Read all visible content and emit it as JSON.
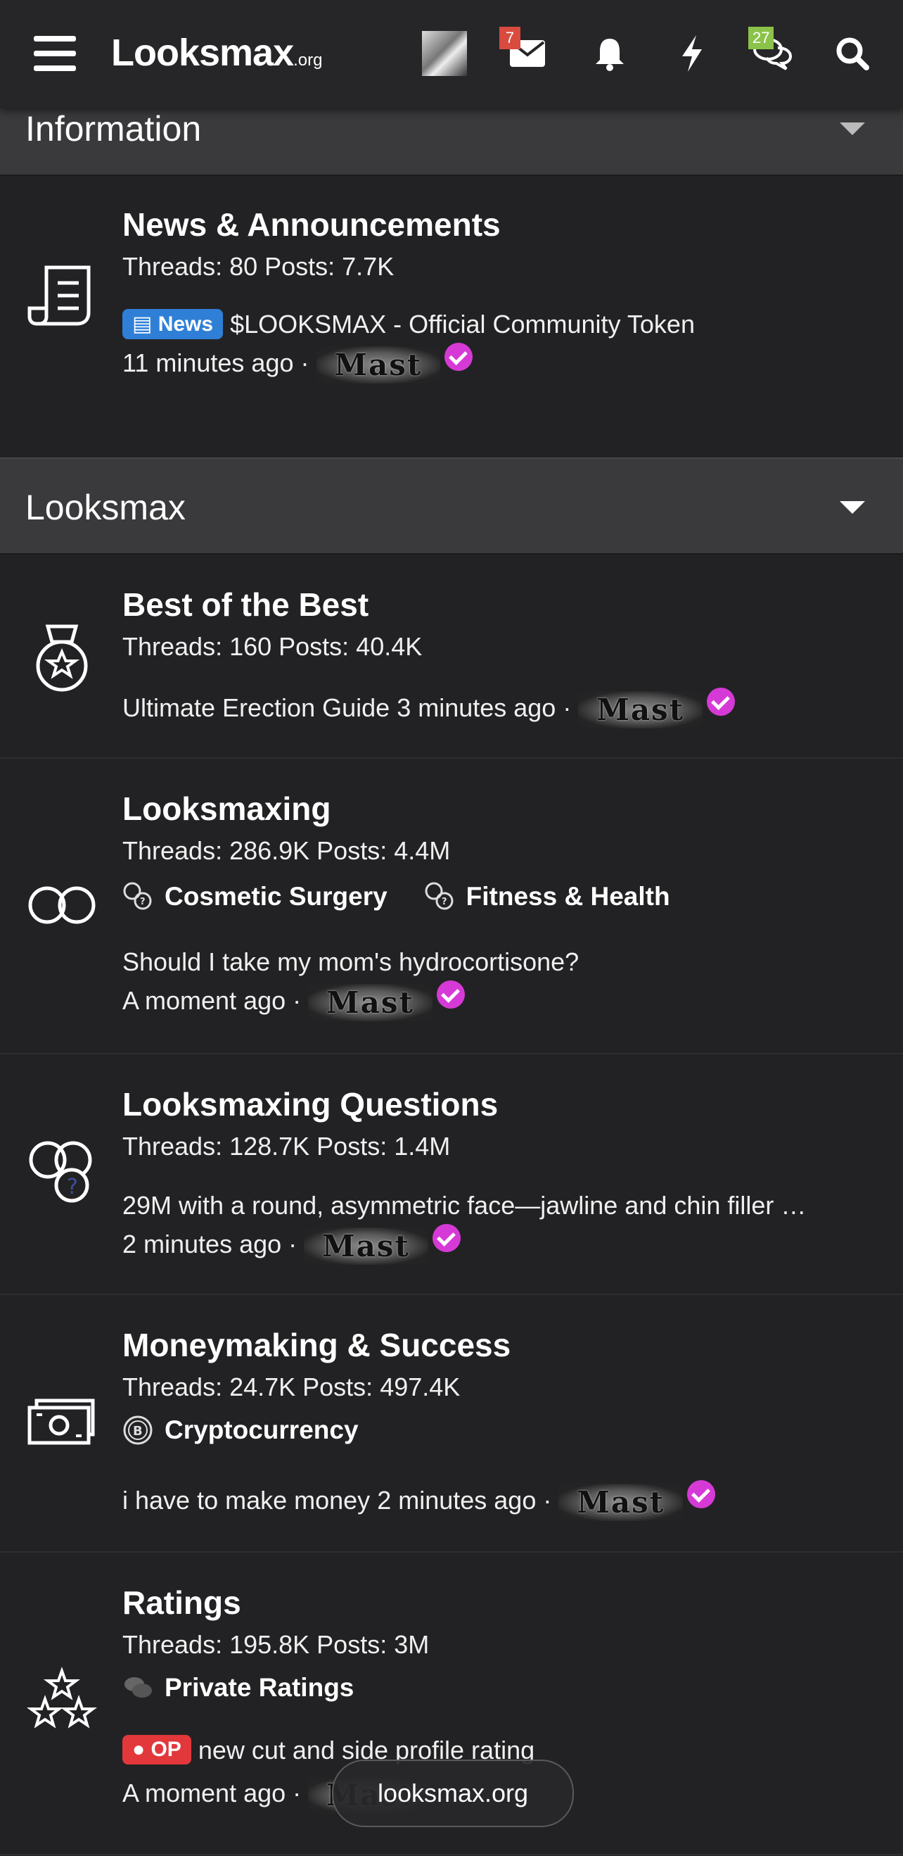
{
  "header": {
    "logo_main": "Looksmax",
    "logo_suffix": ".org",
    "messages_badge": "7",
    "conversations_badge": "27"
  },
  "sections": {
    "information": {
      "title": "Information"
    },
    "looksmax": {
      "title": "Looksmax"
    }
  },
  "forums": {
    "news": {
      "title": "News & Announcements",
      "stats": "Threads: 80 Posts: 7.7K",
      "prefix": "News",
      "latest_thread": "$LOOKSMAX - Official Community Token",
      "time": "11 minutes ago ·",
      "user": "Mast"
    },
    "best": {
      "title": "Best of the Best",
      "stats": "Threads: 160 Posts: 40.4K",
      "latest_thread": "Ultimate Erection Guide",
      "time": "3 minutes ago ·",
      "user": "Mast"
    },
    "looksmaxing": {
      "title": "Looksmaxing",
      "stats": "Threads: 286.9K Posts: 4.4M",
      "subforums": [
        "Cosmetic Surgery",
        "Fitness & Health"
      ],
      "latest_thread": "Should I take my mom's hydrocortisone?",
      "time": "A moment ago ·",
      "user": "Mast"
    },
    "questions": {
      "title": "Looksmaxing Questions",
      "stats": "Threads: 128.7K Posts: 1.4M",
      "latest_thread": "29M with a round, asymmetric face—jawline and chin filler …",
      "time": "2 minutes ago ·",
      "user": "Mast"
    },
    "money": {
      "title": "Moneymaking & Success",
      "stats": "Threads: 24.7K Posts: 497.4K",
      "subforums": [
        "Cryptocurrency"
      ],
      "latest_thread": "i have to make money",
      "time": "2 minutes ago ·",
      "user": "Mast"
    },
    "ratings": {
      "title": "Ratings",
      "stats": "Threads: 195.8K Posts: 3M",
      "subforums": [
        "Private Ratings"
      ],
      "prefix": "OP",
      "latest_thread": "new cut and side profile rating",
      "time": "A moment ago ·",
      "user": "Mast"
    }
  },
  "toast": {
    "label": "looksmax.org"
  },
  "colors": {
    "background": "#222224",
    "section_header": "#3a3a3c",
    "news_prefix": "#2f7fd6",
    "op_prefix": "#e2383b",
    "verified": "#d63ad6",
    "messages_badge": "#d94a3f",
    "conversations_badge": "#8bc34a"
  },
  "icons": [
    "menu-icon",
    "avatar",
    "envelope-icon",
    "bell-icon",
    "bolt-icon",
    "chat-icon",
    "search-icon",
    "newspaper-icon",
    "medal-icon",
    "infinity-icon",
    "question-bubbles-icon",
    "money-icon",
    "stars-icon"
  ]
}
